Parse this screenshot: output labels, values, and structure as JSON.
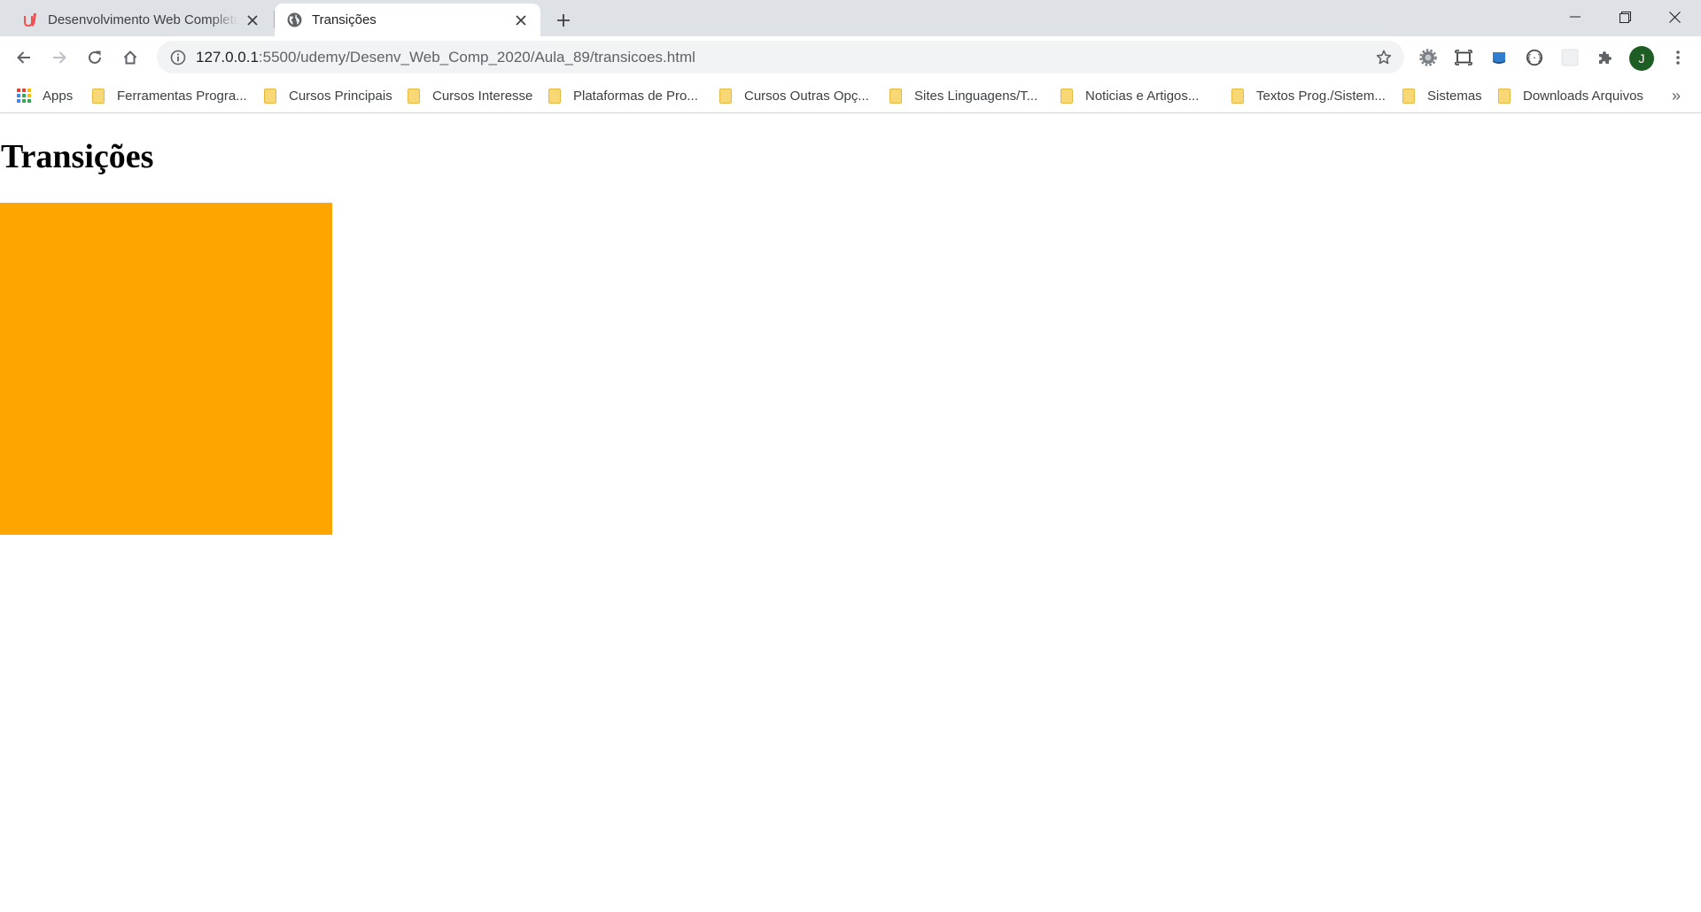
{
  "browser": {
    "tabs": [
      {
        "title": "Desenvolvimento Web Completo",
        "favicon": "udemy-icon",
        "active": false
      },
      {
        "title": "Transições",
        "favicon": "globe-icon",
        "active": true
      }
    ],
    "omnibox": {
      "url_host": "127.0.0.1",
      "url_path": ":5500/udemy/Desenv_Web_Comp_2020/Aula_89/transicoes.html"
    },
    "profile_initial": "J",
    "bookmarks": [
      {
        "label": "Apps",
        "icon": "apps-grid-icon"
      },
      {
        "label": "Ferramentas Progra...",
        "icon": "folder-icon"
      },
      {
        "label": "Cursos Principais",
        "icon": "folder-icon"
      },
      {
        "label": "Cursos Interesse",
        "icon": "folder-icon"
      },
      {
        "label": "Plataformas de Pro...",
        "icon": "folder-icon"
      },
      {
        "label": "Cursos Outras Opç...",
        "icon": "folder-icon"
      },
      {
        "label": "Sites Linguagens/T...",
        "icon": "folder-icon"
      },
      {
        "label": "Noticias e Artigos...",
        "icon": "folder-icon"
      },
      {
        "label": "Textos Prog./Sistem...",
        "icon": "folder-icon"
      },
      {
        "label": "Sistemas",
        "icon": "folder-icon"
      },
      {
        "label": "Downloads Arquivos",
        "icon": "folder-icon"
      }
    ],
    "bookmarks_overflow": "»"
  },
  "page": {
    "heading": "Transições",
    "box_color": "#ffa500"
  },
  "colors": {
    "tabstrip": "#dee1e6",
    "omnibox": "#f1f3f4",
    "folder": "#f8d775",
    "avatar": "#1e5e24"
  }
}
